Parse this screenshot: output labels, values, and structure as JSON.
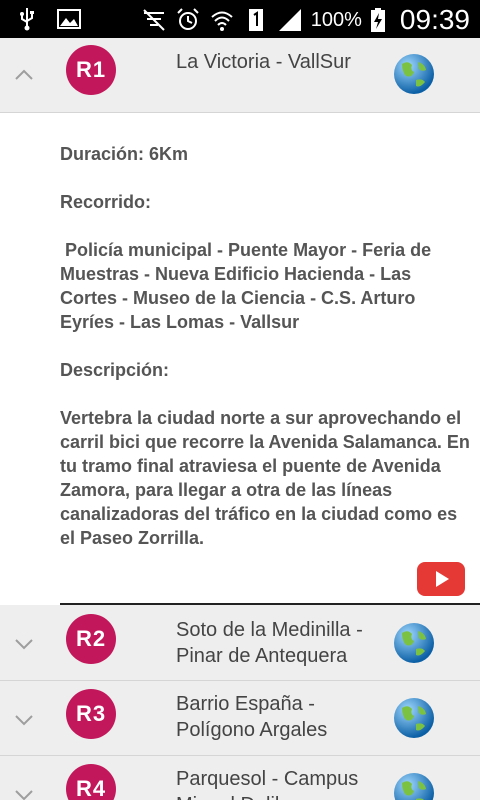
{
  "status_bar": {
    "battery_percent": "100%",
    "time": "09:39"
  },
  "routes": [
    {
      "code": "R1",
      "title": "La Victoria - VallSur",
      "expanded": true
    },
    {
      "code": "R2",
      "title": "Soto de la Medinilla - Pinar de Antequera",
      "expanded": false
    },
    {
      "code": "R3",
      "title": "Barrio España - Polígono Argales",
      "expanded": false
    },
    {
      "code": "R4",
      "title": "Parquesol - Campus Miguel Delibes",
      "expanded": false
    }
  ],
  "detail": {
    "duration": "Duración: 6Km",
    "route_label": "Recorrido:",
    "route_text": " Policía municipal - Puente Mayor - Feria de Muestras - Nueva Edificio Hacienda - Las Cortes - Museo de la Ciencia - C.S. Arturo Eyríes - Las Lomas - Vallsur",
    "description_label": "Descripción:",
    "description_text": "Vertebra la ciudad norte a sur aprovechando el carril bici que recorre la Avenida Salamanca. En tu tramo final atraviesa el puente de Avenida Zamora, para llegar a otra de las líneas canalizadoras del tráfico en la ciudad como es el Paseo Zorrilla."
  },
  "colors": {
    "badge": "#c2185b",
    "row_bg": "#eeeeee",
    "youtube": "#e53935"
  },
  "icons": {
    "map": "globe-icon",
    "video": "youtube-icon"
  }
}
